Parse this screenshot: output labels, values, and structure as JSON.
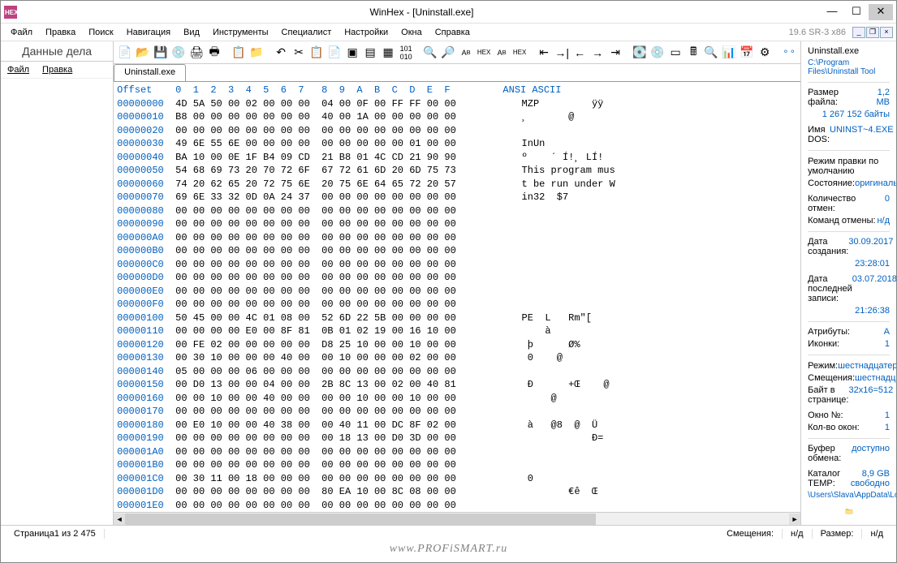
{
  "window": {
    "title": "WinHex - [Uninstall.exe]"
  },
  "version": "19.6 SR-3 x86",
  "menu": [
    "Файл",
    "Правка",
    "Поиск",
    "Навигация",
    "Вид",
    "Инструменты",
    "Специалист",
    "Настройки",
    "Окна",
    "Справка"
  ],
  "left": {
    "title": "Данные дела",
    "menu": [
      "Файл",
      "Правка"
    ]
  },
  "tab": "Uninstall.exe",
  "hexHeader": "Offset    0  1  2  3  4  5  6  7   8  9  A  B  C  D  E  F         ANSI ASCII",
  "rows": [
    {
      "o": "00000000",
      "h": "4D 5A 50 00 02 00 00 00  04 00 0F 00 FF FF 00 00",
      "a": "MZP         ÿÿ"
    },
    {
      "o": "00000010",
      "h": "B8 00 00 00 00 00 00 00  40 00 1A 00 00 00 00 00",
      "a": "¸       @"
    },
    {
      "o": "00000020",
      "h": "00 00 00 00 00 00 00 00  00 00 00 00 00 00 00 00",
      "a": ""
    },
    {
      "o": "00000030",
      "h": "49 6E 55 6E 00 00 00 00  00 00 00 00 00 01 00 00",
      "a": "InUn"
    },
    {
      "o": "00000040",
      "h": "BA 10 00 0E 1F B4 09 CD  21 B8 01 4C CD 21 90 90",
      "a": "º    ´ Í!¸ LÍ!"
    },
    {
      "o": "00000050",
      "h": "54 68 69 73 20 70 72 6F  67 72 61 6D 20 6D 75 73",
      "a": "This program mus"
    },
    {
      "o": "00000060",
      "h": "74 20 62 65 20 72 75 6E  20 75 6E 64 65 72 20 57",
      "a": "t be run under W"
    },
    {
      "o": "00000070",
      "h": "69 6E 33 32 0D 0A 24 37  00 00 00 00 00 00 00 00",
      "a": "in32  $7"
    },
    {
      "o": "00000080",
      "h": "00 00 00 00 00 00 00 00  00 00 00 00 00 00 00 00",
      "a": ""
    },
    {
      "o": "00000090",
      "h": "00 00 00 00 00 00 00 00  00 00 00 00 00 00 00 00",
      "a": ""
    },
    {
      "o": "000000A0",
      "h": "00 00 00 00 00 00 00 00  00 00 00 00 00 00 00 00",
      "a": ""
    },
    {
      "o": "000000B0",
      "h": "00 00 00 00 00 00 00 00  00 00 00 00 00 00 00 00",
      "a": ""
    },
    {
      "o": "000000C0",
      "h": "00 00 00 00 00 00 00 00  00 00 00 00 00 00 00 00",
      "a": ""
    },
    {
      "o": "000000D0",
      "h": "00 00 00 00 00 00 00 00  00 00 00 00 00 00 00 00",
      "a": ""
    },
    {
      "o": "000000E0",
      "h": "00 00 00 00 00 00 00 00  00 00 00 00 00 00 00 00",
      "a": ""
    },
    {
      "o": "000000F0",
      "h": "00 00 00 00 00 00 00 00  00 00 00 00 00 00 00 00",
      "a": ""
    },
    {
      "o": "00000100",
      "h": "50 45 00 00 4C 01 08 00  52 6D 22 5B 00 00 00 00",
      "a": "PE  L   Rm\"["
    },
    {
      "o": "00000110",
      "h": "00 00 00 00 E0 00 8F 81  0B 01 02 19 00 16 10 00",
      "a": "    à"
    },
    {
      "o": "00000120",
      "h": "00 FE 02 00 00 00 00 00  D8 25 10 00 00 10 00 00",
      "a": " þ      Ø%"
    },
    {
      "o": "00000130",
      "h": "00 30 10 00 00 00 40 00  00 10 00 00 00 02 00 00",
      "a": " 0    @"
    },
    {
      "o": "00000140",
      "h": "05 00 00 00 06 00 00 00  00 00 00 00 00 00 00 00",
      "a": ""
    },
    {
      "o": "00000150",
      "h": "00 D0 13 00 00 04 00 00  2B 8C 13 00 02 00 40 81",
      "a": " Ð      +Œ    @"
    },
    {
      "o": "00000160",
      "h": "00 00 10 00 00 40 00 00  00 00 10 00 00 10 00 00",
      "a": "     @"
    },
    {
      "o": "00000170",
      "h": "00 00 00 00 00 00 00 00  00 00 00 00 00 00 00 00",
      "a": ""
    },
    {
      "o": "00000180",
      "h": "00 E0 10 00 00 40 38 00  00 40 11 00 DC 8F 02 00",
      "a": " à   @8  @  Ü"
    },
    {
      "o": "00000190",
      "h": "00 00 00 00 00 00 00 00  00 18 13 00 D0 3D 00 00",
      "a": "            Ð="
    },
    {
      "o": "000001A0",
      "h": "00 00 00 00 00 00 00 00  00 00 00 00 00 00 00 00",
      "a": ""
    },
    {
      "o": "000001B0",
      "h": "00 00 00 00 00 00 00 00  00 00 00 00 00 00 00 00",
      "a": ""
    },
    {
      "o": "000001C0",
      "h": "00 30 11 00 18 00 00 00  00 00 00 00 00 00 00 00",
      "a": " 0"
    },
    {
      "o": "000001D0",
      "h": "00 00 00 00 00 00 00 00  80 EA 10 00 8C 08 00 00",
      "a": "        €ê  Œ"
    },
    {
      "o": "000001E0",
      "h": "00 00 00 00 00 00 00 00  00 00 00 00 00 00 00 00",
      "a": ""
    }
  ],
  "props": {
    "filename": "Uninstall.exe",
    "path": "C:\\Program Files\\Uninstall Tool",
    "sizeLabel": "Размер файла:",
    "sizeVal": "1,2 MB",
    "sizeBytes": "1 267 152 байты",
    "dosLabel": "Имя DOS:",
    "dosVal": "UNINST~4.EXE",
    "editModeLabel": "Режим правки по умолчанию",
    "stateLabel": "Состояние:",
    "stateVal": "оригинальное",
    "undoCountLabel": "Количество отмен:",
    "undoCountVal": "0",
    "undoCmdLabel": "Команд отмены:",
    "undoCmdVal": "н/д",
    "createdLabel": "Дата создания:",
    "createdDate": "30.09.2017",
    "createdTime": "23:28:01",
    "lastwriteLabel": "Дата последней записи:",
    "lastwriteDate": "03.07.2018",
    "lastwriteTime": "21:26:38",
    "attrLabel": "Атрибуты:",
    "attrVal": "A",
    "iconsLabel": "Иконки:",
    "iconsVal": "1",
    "modeLabel": "Режим:",
    "modeVal": "шестнадцатеричный",
    "offsetsLabel": "Смещения:",
    "offsetsVal": "шестнадцатеричный",
    "bppLabel": "Байт в странице:",
    "bppVal": "32x16=512",
    "winNoLabel": "Окно №:",
    "winNoVal": "1",
    "winCntLabel": "Кол-во окон:",
    "winCntVal": "1",
    "clipLabel": "Буфер обмена:",
    "clipVal": "доступно",
    "tempLabel": "Каталог TEMP:",
    "tempVal": "8,9 GB свободно",
    "tempPath": "\\Users\\Slava\\AppData\\Local\\Temp"
  },
  "status": {
    "page": "Страница1 из 2 475",
    "offsets": "Смещения:",
    "na1": "н/д",
    "sizeLbl": "Размер:",
    "na2": "н/д"
  },
  "watermark": "www.PROFiSMART.ru"
}
